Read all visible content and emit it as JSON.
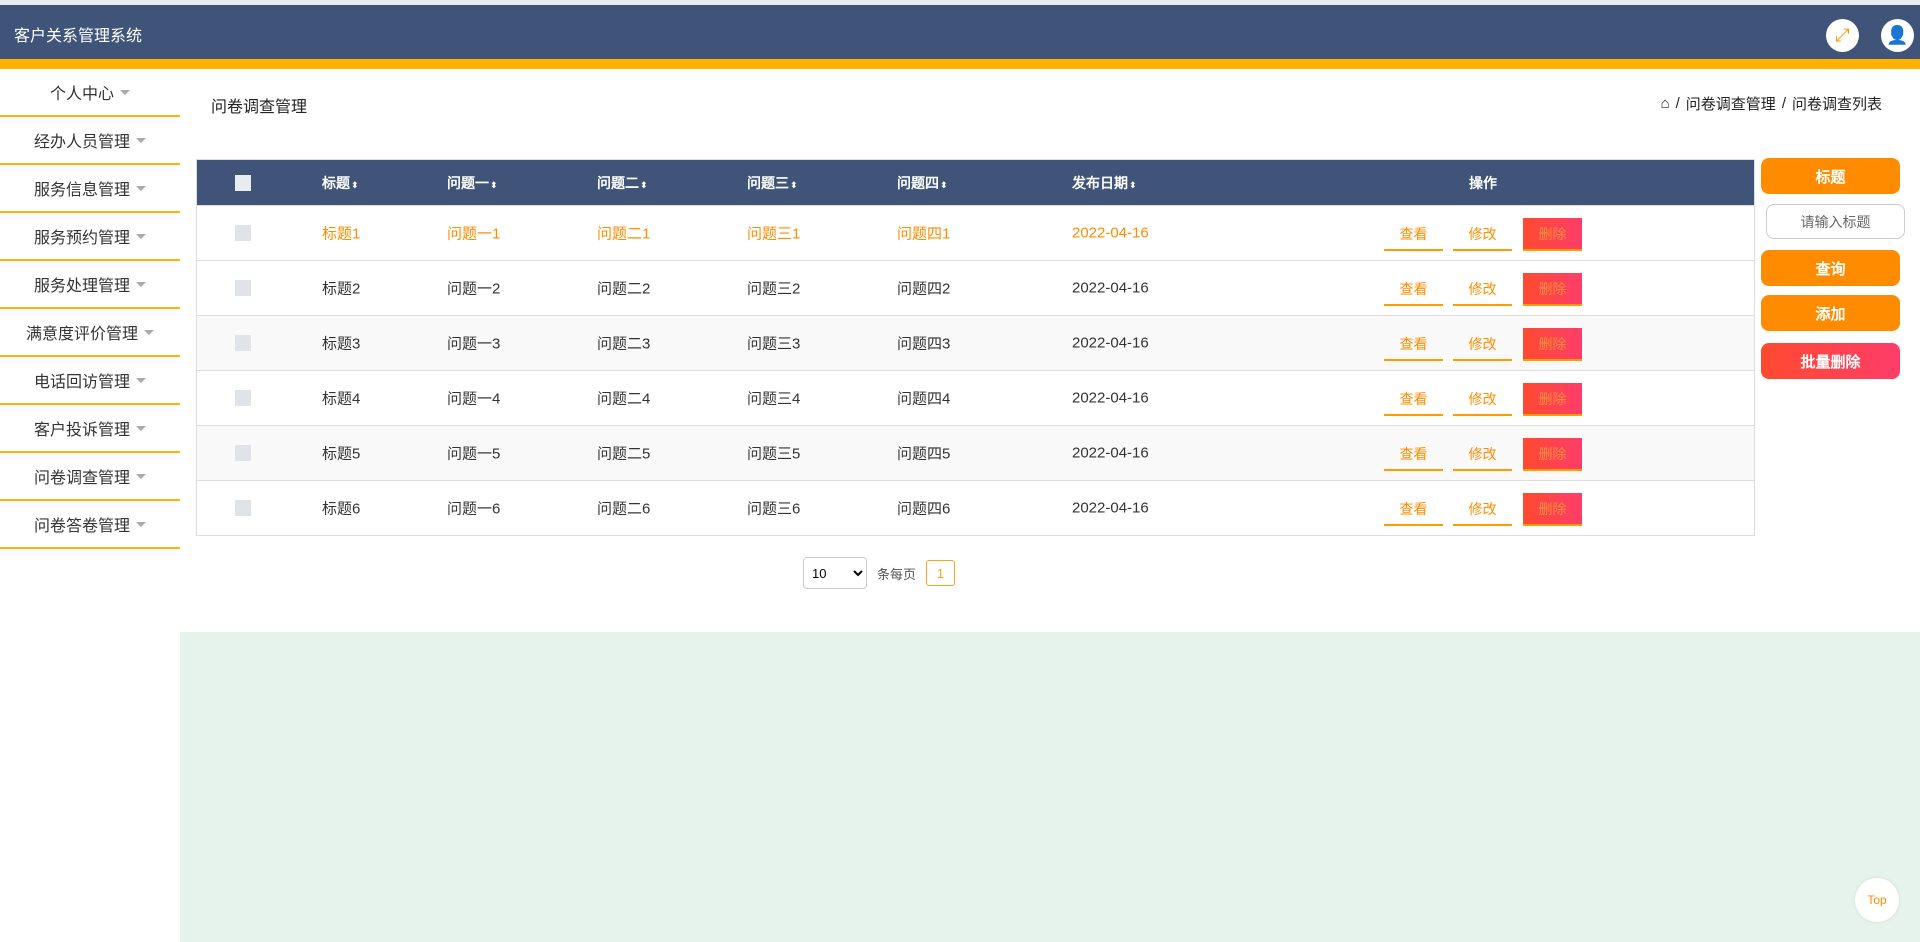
{
  "header": {
    "title": "客户关系管理系统",
    "icons": [
      "fullscreen-icon",
      "user-icon"
    ]
  },
  "sidebar": {
    "items": [
      {
        "label": "个人中心"
      },
      {
        "label": "经办人员管理"
      },
      {
        "label": "服务信息管理"
      },
      {
        "label": "服务预约管理"
      },
      {
        "label": "服务处理管理"
      },
      {
        "label": "满意度评价管理"
      },
      {
        "label": "电话回访管理"
      },
      {
        "label": "客户投诉管理"
      },
      {
        "label": "问卷调查管理"
      },
      {
        "label": "问卷答卷管理"
      }
    ]
  },
  "page": {
    "title": "问卷调查管理",
    "breadcrumb": [
      "问卷调查管理",
      "问卷调查列表"
    ]
  },
  "table": {
    "columns": [
      "标题",
      "问题一",
      "问题二",
      "问题三",
      "问题四",
      "发布日期",
      "操作"
    ],
    "rows": [
      [
        "标题1",
        "问题一1",
        "问题二1",
        "问题三1",
        "问题四1",
        "2022-04-16"
      ],
      [
        "标题2",
        "问题一2",
        "问题二2",
        "问题三2",
        "问题四2",
        "2022-04-16"
      ],
      [
        "标题3",
        "问题一3",
        "问题二3",
        "问题三3",
        "问题四3",
        "2022-04-16"
      ],
      [
        "标题4",
        "问题一4",
        "问题二4",
        "问题三4",
        "问题四4",
        "2022-04-16"
      ],
      [
        "标题5",
        "问题一5",
        "问题二5",
        "问题三5",
        "问题四5",
        "2022-04-16"
      ],
      [
        "标题6",
        "问题一6",
        "问题二6",
        "问题三6",
        "问题四6",
        "2022-04-16"
      ]
    ],
    "actions": {
      "view": "查看",
      "edit": "修改",
      "delete": "删除"
    }
  },
  "search": {
    "label": "标题",
    "placeholder": "请输入标题",
    "query": "查询",
    "add": "添加",
    "batch_delete": "批量删除"
  },
  "pagination": {
    "page_size": "10",
    "per_page_label": "条每页",
    "current_page": "1"
  },
  "top_button": "Top",
  "colors": {
    "header": "#3f5478",
    "accent": "#ffb300",
    "button": "#ff8c00",
    "danger": "#ff4a2f",
    "background_panel": "#e6f2ec"
  }
}
